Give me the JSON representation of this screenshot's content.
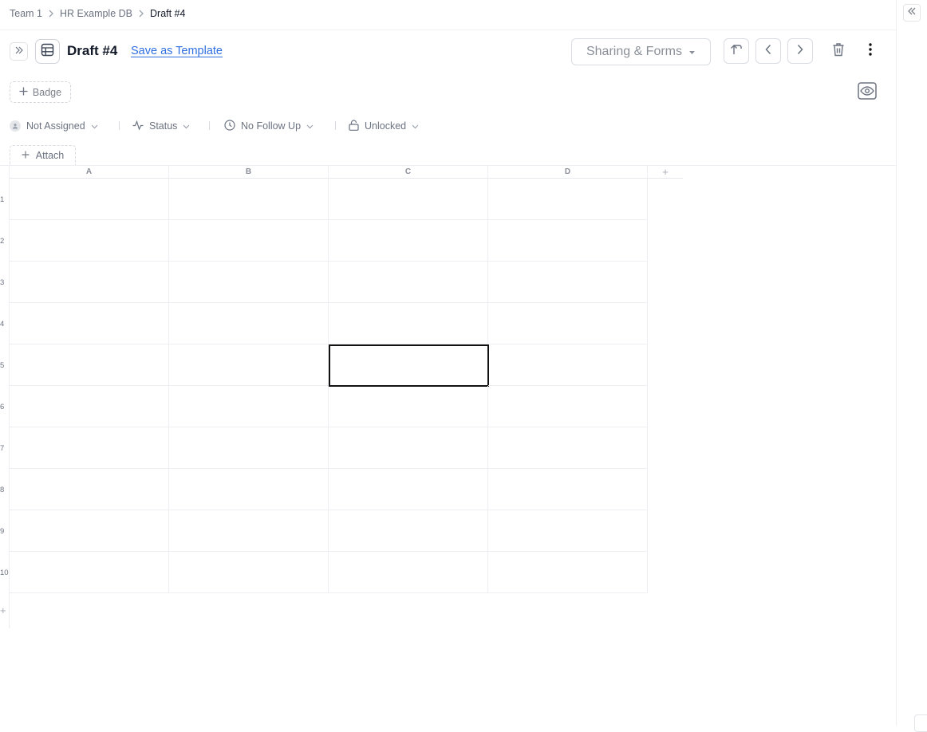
{
  "breadcrumb": {
    "items": [
      "Team 1",
      "HR Example DB",
      "Draft #4"
    ]
  },
  "header": {
    "title": "Draft #4",
    "save_template": "Save as Template",
    "sharing": "Sharing & Forms"
  },
  "badge": {
    "label": "Badge"
  },
  "properties": {
    "assignee": "Not Assigned",
    "status": "Status",
    "follow_up": "No Follow Up",
    "lock": "Unlocked"
  },
  "attach": {
    "label": "Attach"
  },
  "sheet": {
    "columns": [
      "A",
      "B",
      "C",
      "D"
    ],
    "add_column": "+",
    "rows": [
      "1",
      "2",
      "3",
      "4",
      "5",
      "6",
      "7",
      "8",
      "9",
      "10"
    ],
    "add_row": "+",
    "selected_cell": "C5"
  },
  "icons": {
    "collapse": "double-chevron-left-icon",
    "expand": "double-chevron-right-icon",
    "table": "table-icon",
    "up": "arrow-up-icon",
    "prev": "chevron-left-icon",
    "next": "chevron-right-icon",
    "delete": "trash-icon",
    "more": "vertical-dots-icon",
    "preview": "eye-icon"
  },
  "colors": {
    "link": "#2f6fe0",
    "text": "#111827",
    "muted": "#6b7280"
  }
}
